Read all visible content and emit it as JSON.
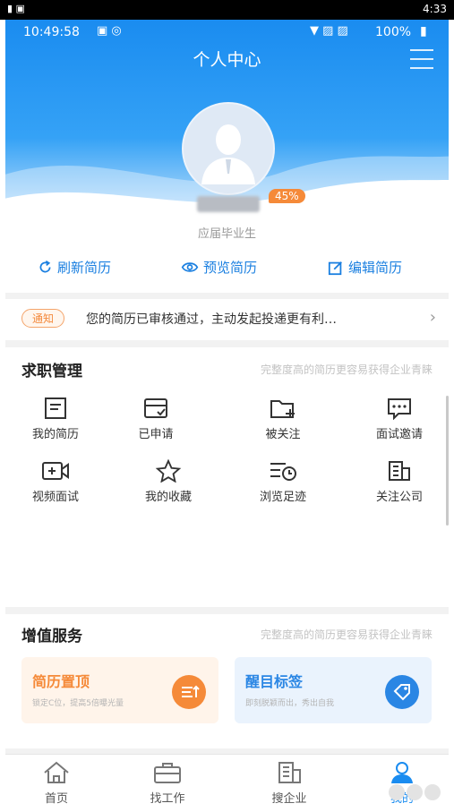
{
  "outer_status": {
    "time": "4:33"
  },
  "inner_status": {
    "time": "10:49:58",
    "battery": "100%"
  },
  "header": {
    "title": "个人中心"
  },
  "profile": {
    "completion": "45%",
    "subtitle": "应届毕业生"
  },
  "actions": [
    {
      "label": "刷新简历",
      "icon": "refresh-icon"
    },
    {
      "label": "预览简历",
      "icon": "eye-icon"
    },
    {
      "label": "编辑简历",
      "icon": "edit-icon"
    }
  ],
  "notice": {
    "badge": "通知",
    "text": "您的简历已审核通过，主动发起投递更有利…"
  },
  "job_management": {
    "title": "求职管理",
    "hint": "完整度高的简历更容易获得企业青睐",
    "items": [
      {
        "label": "我的简历",
        "icon": "resume-icon"
      },
      {
        "label": "已申请",
        "icon": "applied-icon"
      },
      {
        "label": "被关注",
        "icon": "followed-folder-icon"
      },
      {
        "label": "面试邀请",
        "icon": "chat-icon"
      },
      {
        "label": "视频面试",
        "icon": "video-icon"
      },
      {
        "label": "我的收藏",
        "icon": "star-icon"
      },
      {
        "label": "浏览足迹",
        "icon": "history-icon"
      },
      {
        "label": "关注公司",
        "icon": "building-icon"
      }
    ]
  },
  "value_services": {
    "title": "增值服务",
    "hint": "完整度高的简历更容易获得企业青睐",
    "tiles": [
      {
        "title": "简历置顶",
        "subtitle": "锁定C位，提高5倍曝光量",
        "color": "#f58a39",
        "bg": "#fff4ea",
        "icon": "top-up-icon"
      },
      {
        "title": "醒目标签",
        "subtitle": "即刻脱颖而出，秀出自我",
        "color": "#2a86e4",
        "bg": "#eaf3fd",
        "icon": "tag-icon"
      }
    ]
  },
  "tabbar": [
    {
      "label": "首页",
      "icon": "home-icon"
    },
    {
      "label": "找工作",
      "icon": "briefcase-icon"
    },
    {
      "label": "搜企业",
      "icon": "company-icon"
    },
    {
      "label": "我的",
      "icon": "user-icon"
    }
  ],
  "colors": {
    "primary": "#1a8cf0",
    "accent": "#f58a39"
  }
}
